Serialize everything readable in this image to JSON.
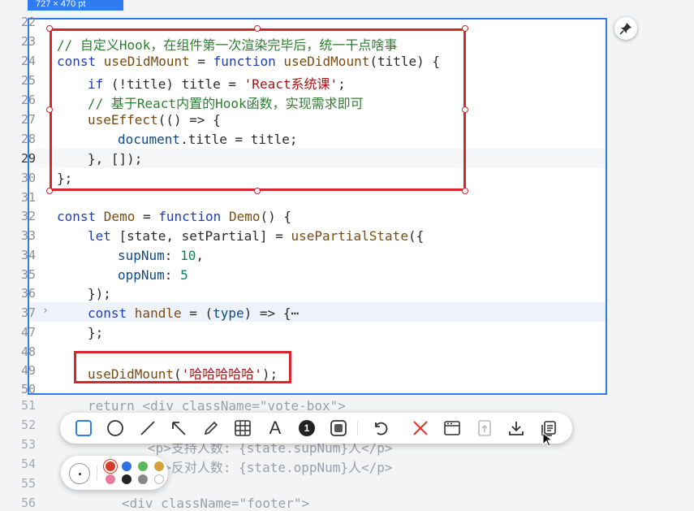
{
  "size_badge": "727 × 470 pt",
  "colors": {
    "selection_border": "#2f7bf2",
    "annotation_red": "#d9252b",
    "tool_active": "#2f7bf2"
  },
  "background_lines": [
    {
      "num": "51",
      "text": "return <div className=\"vote-box\">"
    },
    {
      "num": "52",
      "text": ""
    },
    {
      "num": "53",
      "text": "<p>支持人数: {state.supNum}人</p>"
    },
    {
      "num": "54",
      "text": "<p>反对人数: {state.oppNum}人</p>"
    },
    {
      "num": "55",
      "text": ""
    },
    {
      "num": "56",
      "text": "<div className=\"footer\">"
    }
  ],
  "lines": [
    {
      "num": "22"
    },
    {
      "num": "23",
      "c": "// 自定义Hook，在组件第一次渲染完毕后，统一干点啥事"
    },
    {
      "num": "24",
      "a": "const ",
      "b": "useDidMount",
      "c2": " = ",
      "d": "function ",
      "e": "useDidMount",
      "f": "(title) {"
    },
    {
      "num": "25",
      "a": "if ",
      "b": "(!title) title = ",
      "c": "'React系统课'",
      "d": ";"
    },
    {
      "num": "26",
      "c": "// 基于React内置的Hook函数，实现需求即可"
    },
    {
      "num": "27",
      "a": "useEffect",
      "b": "(() => {"
    },
    {
      "num": "28",
      "a": "document",
      "b": ".title = title;"
    },
    {
      "num": "29",
      "a": "}, []);"
    },
    {
      "num": "30",
      "a": "};"
    },
    {
      "num": "31"
    },
    {
      "num": "32",
      "a": "const ",
      "b": "Demo",
      "c2": " = ",
      "d": "function ",
      "e": "Demo",
      "f": "() {"
    },
    {
      "num": "33",
      "a": "let ",
      "b": "[state, setPartial] = ",
      "c": "usePartialState",
      "d": "({"
    },
    {
      "num": "34",
      "a": "supNum",
      "b": ": ",
      "c": "10",
      "d": ","
    },
    {
      "num": "35",
      "a": "oppNum",
      "b": ": ",
      "c": "5"
    },
    {
      "num": "36",
      "a": "});"
    },
    {
      "num": "37",
      "a": "const ",
      "b": "handle",
      "c2": " = (",
      "d": "type",
      "e": ") => {",
      "f": "⋯"
    },
    {
      "num": "47",
      "a": "};"
    },
    {
      "num": "48"
    },
    {
      "num": "49",
      "a": "useDidMount",
      "b": "(",
      "c": "'哈哈哈哈哈'",
      "d": ");"
    },
    {
      "num": "50"
    }
  ],
  "fold_glyph": "›",
  "toolbar": {
    "tools": [
      "rectangle-icon",
      "ellipse-icon",
      "line-icon",
      "arrow-icon",
      "pen-icon",
      "mosaic-icon",
      "text-icon",
      "number-marker-icon",
      "highlight-icon",
      "undo-icon",
      "cancel-icon",
      "window-icon",
      "pin-to-screen-icon",
      "download-icon",
      "copy-icon"
    ],
    "number_marker_label": "1",
    "text_tool_label": "A"
  },
  "palette": {
    "swatches": [
      "#d43d2b",
      "#2f6fe0",
      "#5bb85b",
      "#d4a23c",
      "#e87a9a",
      "#222222",
      "#888888",
      "#ffffff"
    ]
  }
}
